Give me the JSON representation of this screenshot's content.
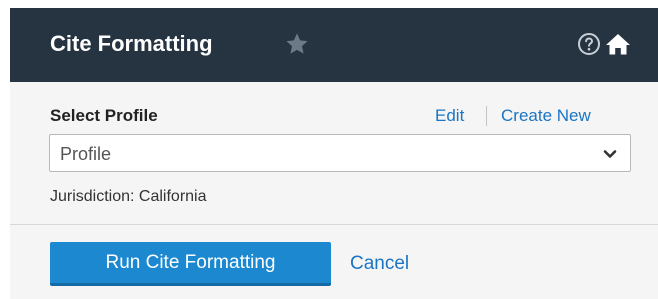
{
  "header": {
    "title": "Cite Formatting",
    "star_icon": "star-icon",
    "help_icon": "help-circle-icon",
    "home_icon": "home-icon",
    "background_color": "#263442",
    "star_color": "#6c7a87"
  },
  "profile_section": {
    "label": "Select Profile",
    "edit_label": "Edit",
    "create_new_label": "Create New",
    "select_value": "Profile",
    "chevron_icon": "chevron-down-icon",
    "jurisdiction_text": "Jurisdiction: California"
  },
  "footer": {
    "run_button_label": "Run Cite Formatting",
    "cancel_label": "Cancel",
    "accent_color": "#1b88d0",
    "link_color": "#1a75c4"
  }
}
